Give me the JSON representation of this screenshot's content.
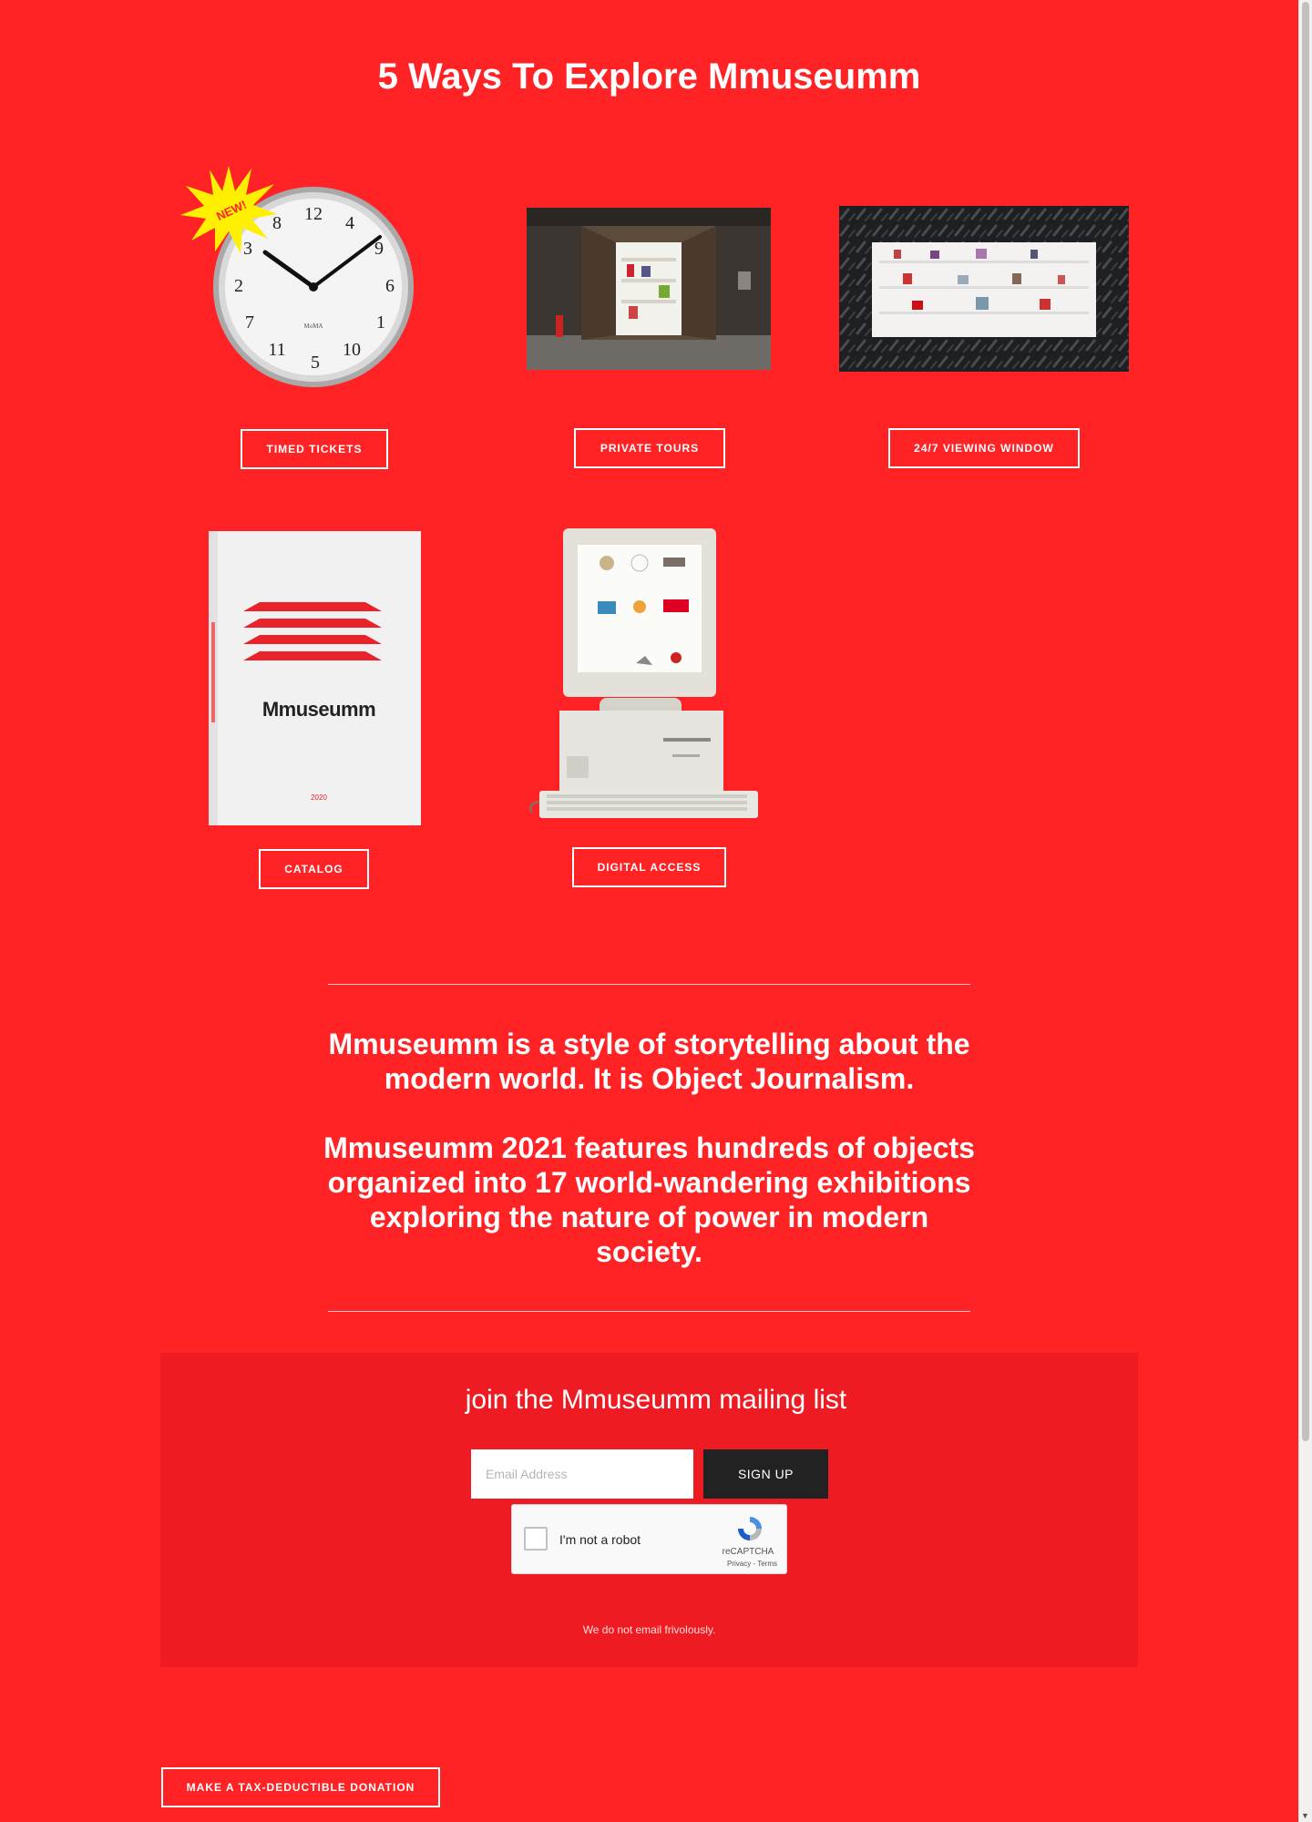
{
  "page": {
    "title": "5 Ways To Explore Mmuseumm",
    "background": "#ff2326"
  },
  "cards": [
    {
      "label": "TIMED TICKETS",
      "image": "wall-clock",
      "badge": "NEW!"
    },
    {
      "label": "PRIVATE TOURS",
      "image": "elevator-shaft-museum-doorway"
    },
    {
      "label": "24/7 VIEWING WINDOW",
      "image": "diamond-plate-window-display"
    },
    {
      "label": "CATALOG",
      "image": "catalog-book",
      "book_title": "Mmuseumm",
      "book_year": "2020"
    },
    {
      "label": "DIGITAL ACCESS",
      "image": "retro-computer"
    }
  ],
  "blurb": {
    "p1": "Mmuseumm is a style of storytelling about the modern world. It is Object Journalism.",
    "p2": "Mmuseumm 2021 features hundreds of objects organized into 17 world-wandering exhibitions exploring the nature of power in modern society."
  },
  "mailing": {
    "heading": "join the Mmuseumm mailing list",
    "email_placeholder": "Email Address",
    "signup_label": "SIGN UP",
    "captcha_label": "I'm not a robot",
    "captcha_brand": "reCAPTCHA",
    "captcha_terms": "Privacy - Terms",
    "disclaimer": "We do not email frivolously."
  },
  "donation": {
    "label": "MAKE A TAX-DEDUCTIBLE DONATION"
  }
}
